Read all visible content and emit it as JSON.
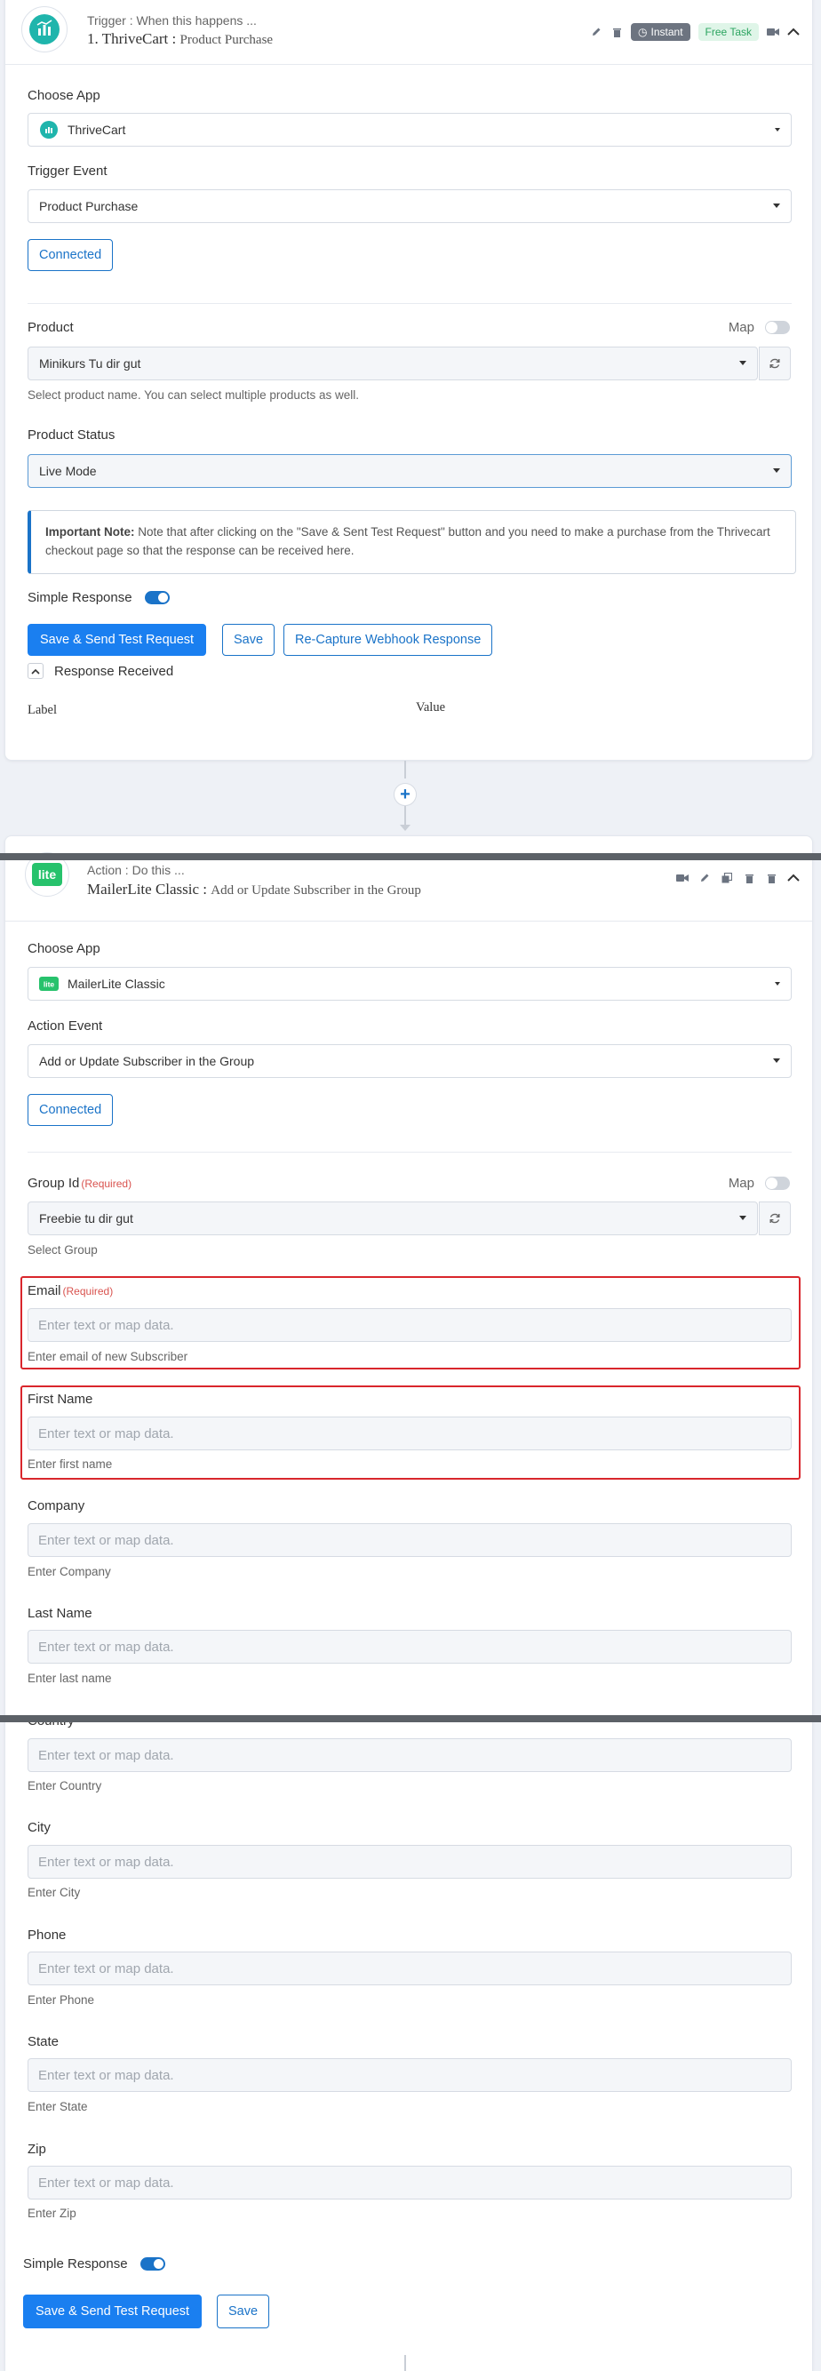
{
  "trigger_card": {
    "subtitle": "Trigger : When this happens ...",
    "title_app": "1. ThriveCart :",
    "title_event": "Product Purchase",
    "badge_instant": "Instant",
    "badge_free": "Free Task",
    "choose_app_label": "Choose App",
    "choose_app_value": "ThriveCart",
    "trigger_event_label": "Trigger Event",
    "trigger_event_value": "Product Purchase",
    "connected_label": "Connected",
    "product_label": "Product",
    "map_label": "Map",
    "product_value": "Minikurs Tu dir gut",
    "product_help": "Select product name. You can select multiple products as well.",
    "product_status_label": "Product Status",
    "product_status_value": "Live Mode",
    "note_bold": "Important Note:",
    "note_text": " Note that after clicking on the \"Save & Sent Test Request\" button and you need to make a purchase from the Thrivecart checkout page so that the response can be received here.",
    "simple_response_label": "Simple Response",
    "save_send_label": "Save & Send Test Request",
    "save_label": "Save",
    "recapture_label": "Re-Capture Webhook Response",
    "response_received_label": "Response Received",
    "col_label": "Label",
    "col_value": "Value"
  },
  "action_card": {
    "subtitle": "Action : Do this ...",
    "title_app": "MailerLite Classic :",
    "title_event": "Add or Update Subscriber in the Group",
    "logo_text": "lite",
    "choose_app_label": "Choose App",
    "choose_app_value": "MailerLite Classic",
    "action_event_label": "Action Event",
    "action_event_value": "Add or Update Subscriber in the Group",
    "connected_label": "Connected",
    "group_label": "Group Id",
    "required": "(Required)",
    "map_label": "Map",
    "group_value": "Freebie tu dir gut",
    "group_help": "Select Group",
    "placeholder": "Enter text or map data.",
    "fields": [
      {
        "label": "Email",
        "required": true,
        "help": "Enter email of new Subscriber"
      },
      {
        "label": "First Name",
        "required": false,
        "help": "Enter first name"
      },
      {
        "label": "Company",
        "required": false,
        "help": "Enter Company"
      },
      {
        "label": "Last Name",
        "required": false,
        "help": "Enter last name"
      },
      {
        "label": "Country",
        "required": false,
        "help": "Enter Country"
      },
      {
        "label": "City",
        "required": false,
        "help": "Enter City"
      },
      {
        "label": "Phone",
        "required": false,
        "help": "Enter Phone"
      },
      {
        "label": "State",
        "required": false,
        "help": "Enter State"
      },
      {
        "label": "Zip",
        "required": false,
        "help": "Enter Zip"
      }
    ],
    "simple_response_label": "Simple Response",
    "save_send_label": "Save & Send Test Request",
    "save_label": "Save"
  },
  "colors": {
    "primary": "#1a7ff0",
    "link": "#1a73c8",
    "highlight": "#d9262c",
    "thrivecart": "#1fb5ac",
    "mailerlite": "#27c26c"
  }
}
